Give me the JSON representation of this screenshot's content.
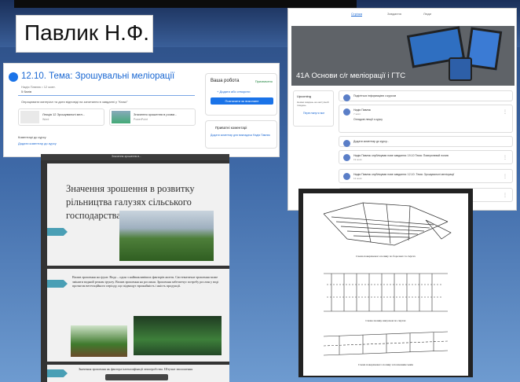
{
  "slide_caption": "Павлик Н.Ф.",
  "assignment": {
    "title": "12.10. Тема: Зрошувальні меліорації",
    "author_meta": "Надія Павлик • 12 жовт.",
    "points": "5 балів",
    "description": "Опрацювати матеріал та дати відповіді на запитання в завданні у \"Класі\"",
    "attachments": [
      {
        "name": "Лекція 12 Зрошувальні мел...",
        "type": "Word"
      },
      {
        "name": "Значення зрошення в розви...",
        "type": "PowerPoint"
      }
    ],
    "class_comments": "Коментарі до курсу",
    "add_comment": "Додати коментар до курсу",
    "your_work": {
      "heading": "Ваша робота",
      "status": "Призначено",
      "add_label": "+ Додати або створити",
      "submit": "Позначити як виконане"
    },
    "private_comments": {
      "heading": "Приватні коментарі",
      "add": "Додати коментар для викладача Надія Павлик"
    }
  },
  "stream": {
    "tabs": [
      "Стрічка",
      "Завдання",
      "Люди"
    ],
    "active_tab": "Стрічка",
    "banner_title": "41А Основи с/г меліорації і ГТС",
    "upcoming": {
      "heading": "Upcoming",
      "text": "Немає завдань на наступний тиждень",
      "link": "Переглянути все"
    },
    "posts": [
      {
        "name": "Поділіться інформацією з курсом",
        "date": "",
        "body": ""
      },
      {
        "name": "Надія Павлик",
        "date": "7 жовт.",
        "body": "Оглядові лекції з курсу"
      },
      {
        "name": "Додати коментар до курсу...",
        "date": "",
        "body": ""
      },
      {
        "name": "Надія Павлик опублікував нове завдання: 19.10 Тема: Поверхневий полив",
        "date": "19 жовт.",
        "body": ""
      },
      {
        "name": "Надія Павлик опублікував нове завдання: 12.10. Тема: Зрошувальні меліорації",
        "date": "12 жовт.",
        "body": ""
      },
      {
        "name": "Надія Павлик опублікував нове завдання",
        "date": "5 жовт.",
        "body": ""
      }
    ]
  },
  "presentation": {
    "header": "Значення зрошення в...",
    "slide_title": "Значення зрошення в розвитку рільництва галузях сільського господарства",
    "slide2_text": "Вплив зрошення на ґрунт. Вода – один з найважливіших факторів життя. Систематичне зрошення може змінити водний режим ґрунту. Вплив зрошення на рослини. Зрошення забезпечує потребу рослин у воді протягом вегетаційного періоду, що підвищує врожайність і якість продукції.",
    "slide3_text": "Значення зрошення як фактора інтенсифікації землеробства. Штучне зволоження"
  },
  "document": {
    "caption1": "Схема поверхневого поливу по борознах та смугах",
    "caption2": "Схема поливу напуском по смугах",
    "caption3": "Схема поверхневого поливу затопленням чеків"
  }
}
